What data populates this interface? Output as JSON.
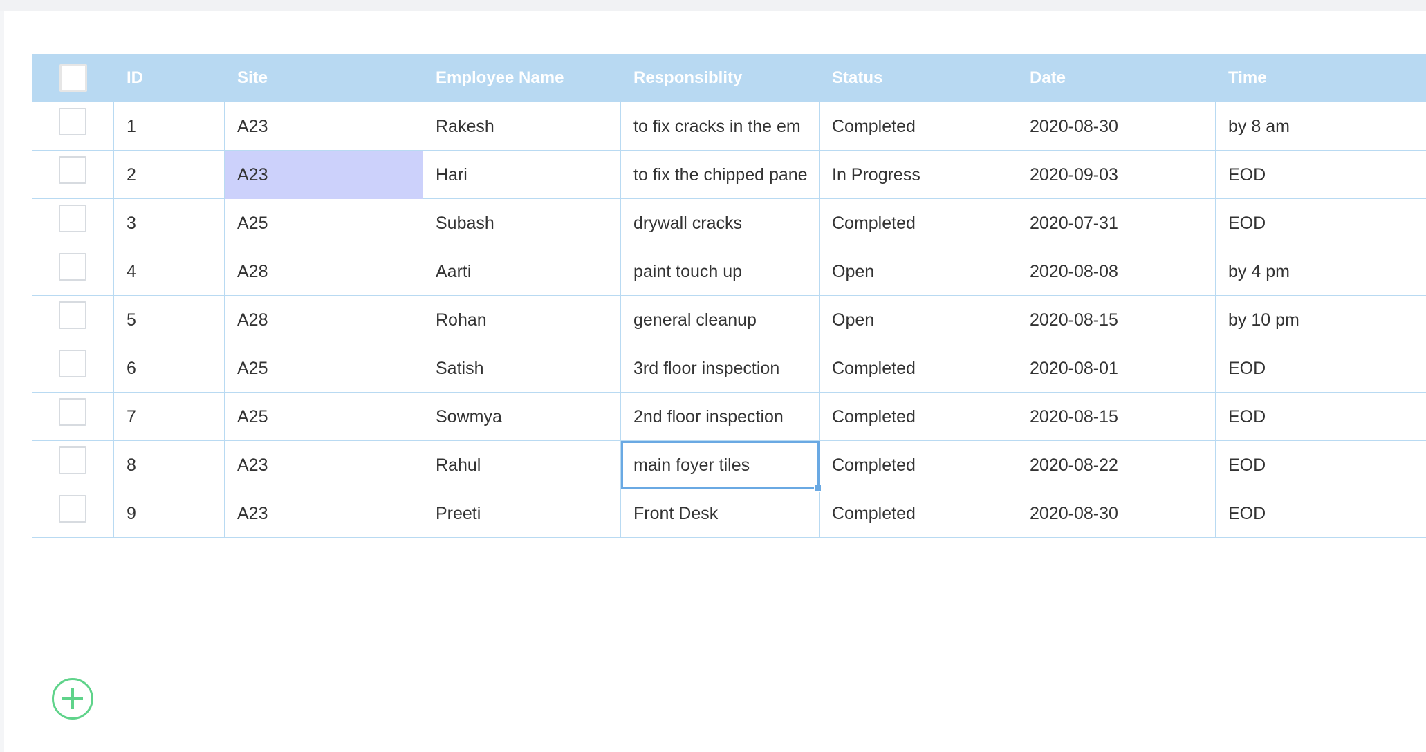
{
  "columns": {
    "id": "ID",
    "site": "Site",
    "employee_name": "Employee Name",
    "responsibility": "Responsiblity",
    "status": "Status",
    "date": "Date",
    "time": "Time"
  },
  "rows": [
    {
      "id": "1",
      "site": "A23",
      "name": "Rakesh",
      "resp": "to fix cracks in the em",
      "status": "Completed",
      "date": "2020-08-30",
      "time": "by 8 am"
    },
    {
      "id": "2",
      "site": "A23",
      "name": "Hari",
      "resp": "to fix the chipped pane",
      "status": "In Progress",
      "date": "2020-09-03",
      "time": "EOD"
    },
    {
      "id": "3",
      "site": "A25",
      "name": "Subash",
      "resp": "drywall cracks",
      "status": "Completed",
      "date": "2020-07-31",
      "time": "EOD"
    },
    {
      "id": "4",
      "site": "A28",
      "name": "Aarti",
      "resp": "paint touch up",
      "status": "Open",
      "date": "2020-08-08",
      "time": "by 4 pm"
    },
    {
      "id": "5",
      "site": "A28",
      "name": "Rohan",
      "resp": "general cleanup",
      "status": "Open",
      "date": "2020-08-15",
      "time": "by 10 pm"
    },
    {
      "id": "6",
      "site": "A25",
      "name": "Satish",
      "resp": "3rd floor inspection",
      "status": "Completed",
      "date": "2020-08-01",
      "time": "EOD"
    },
    {
      "id": "7",
      "site": "A25",
      "name": "Sowmya",
      "resp": "2nd floor inspection",
      "status": "Completed",
      "date": "2020-08-15",
      "time": "EOD"
    },
    {
      "id": "8",
      "site": "A23",
      "name": "Rahul",
      "resp": "main foyer tiles",
      "status": "Completed",
      "date": "2020-08-22",
      "time": "EOD"
    },
    {
      "id": "9",
      "site": "A23",
      "name": "Preeti",
      "resp": "Front Desk",
      "status": "Completed",
      "date": "2020-08-30",
      "time": "EOD"
    }
  ],
  "colors": {
    "header_bg": "#b8d9f2",
    "grid_line": "#b9daf2",
    "highlight": "#ccd1fb",
    "selection": "#6aa9e3",
    "add_button": "#5fd38a"
  },
  "icons": {
    "add_row": "plus-circle-icon"
  }
}
